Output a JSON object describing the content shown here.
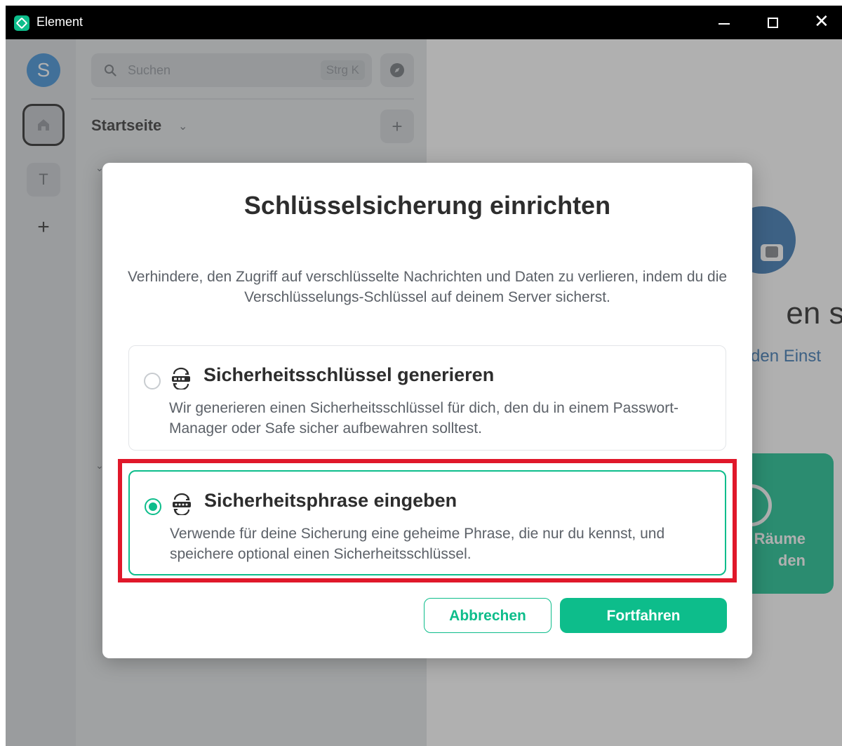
{
  "window": {
    "title": "Element"
  },
  "space_panel": {
    "user_initial": "S",
    "space_initial": "T",
    "add_label": "+"
  },
  "room_panel": {
    "search_placeholder": "Suchen",
    "search_shortcut": "Strg K",
    "heading": "Startseite",
    "add_label": "+"
  },
  "main": {
    "heading_fragment": "en sg",
    "sub_fragment": "den Einst",
    "card_text_line1": "e Räume",
    "card_text_line2": "den"
  },
  "modal": {
    "title": "Schlüsselsicherung einrichten",
    "description": "Verhindere, den Zugriff auf verschlüsselte Nachrichten und Daten zu verlieren, indem du die Verschlüsselungs-Schlüssel auf deinem Server sicherst.",
    "options": [
      {
        "title": "Sicherheitsschlüssel generieren",
        "description": "Wir generieren einen Sicherheitsschlüssel für dich, den du in einem Passwort-Manager oder Safe sicher aufbewahren solltest.",
        "selected": false,
        "icon": "key-icon"
      },
      {
        "title": "Sicherheitsphrase eingeben",
        "description": "Verwende für deine Sicherung eine geheime Phrase, die nur du kennst, und speichere optional einen Sicherheitsschlüssel.",
        "selected": true,
        "icon": "password-icon"
      }
    ],
    "cancel_label": "Abbrechen",
    "continue_label": "Fortfahren"
  },
  "colors": {
    "accent": "#0dbd8b",
    "highlight": "#e0182a",
    "avatar": "#368bd6"
  }
}
